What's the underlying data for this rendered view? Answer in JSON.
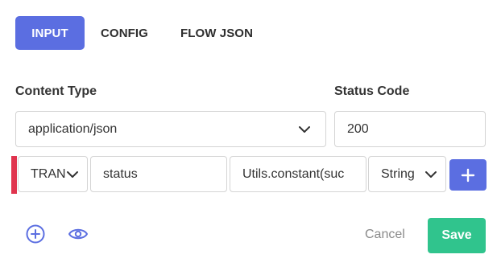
{
  "tabs": [
    {
      "label": "INPUT",
      "active": true
    },
    {
      "label": "CONFIG",
      "active": false
    },
    {
      "label": "FLOW JSON",
      "active": false
    }
  ],
  "form": {
    "content_type_label": "Content Type",
    "content_type_value": "application/json",
    "status_code_label": "Status Code",
    "status_code_value": "200"
  },
  "row": {
    "type_value": "TRAN",
    "key_value": "status",
    "value_value": "Utils.constant(suc",
    "data_type_value": "String"
  },
  "actions": {
    "cancel_label": "Cancel",
    "save_label": "Save"
  },
  "icons": {
    "add_row": "plus-icon",
    "add_circle": "plus-circle-icon",
    "preview": "eye-icon",
    "dropdown": "chevron-down-icon"
  },
  "colors": {
    "accent": "#5b6ee1",
    "save": "#30c48d",
    "error_bar": "#e0344e"
  }
}
